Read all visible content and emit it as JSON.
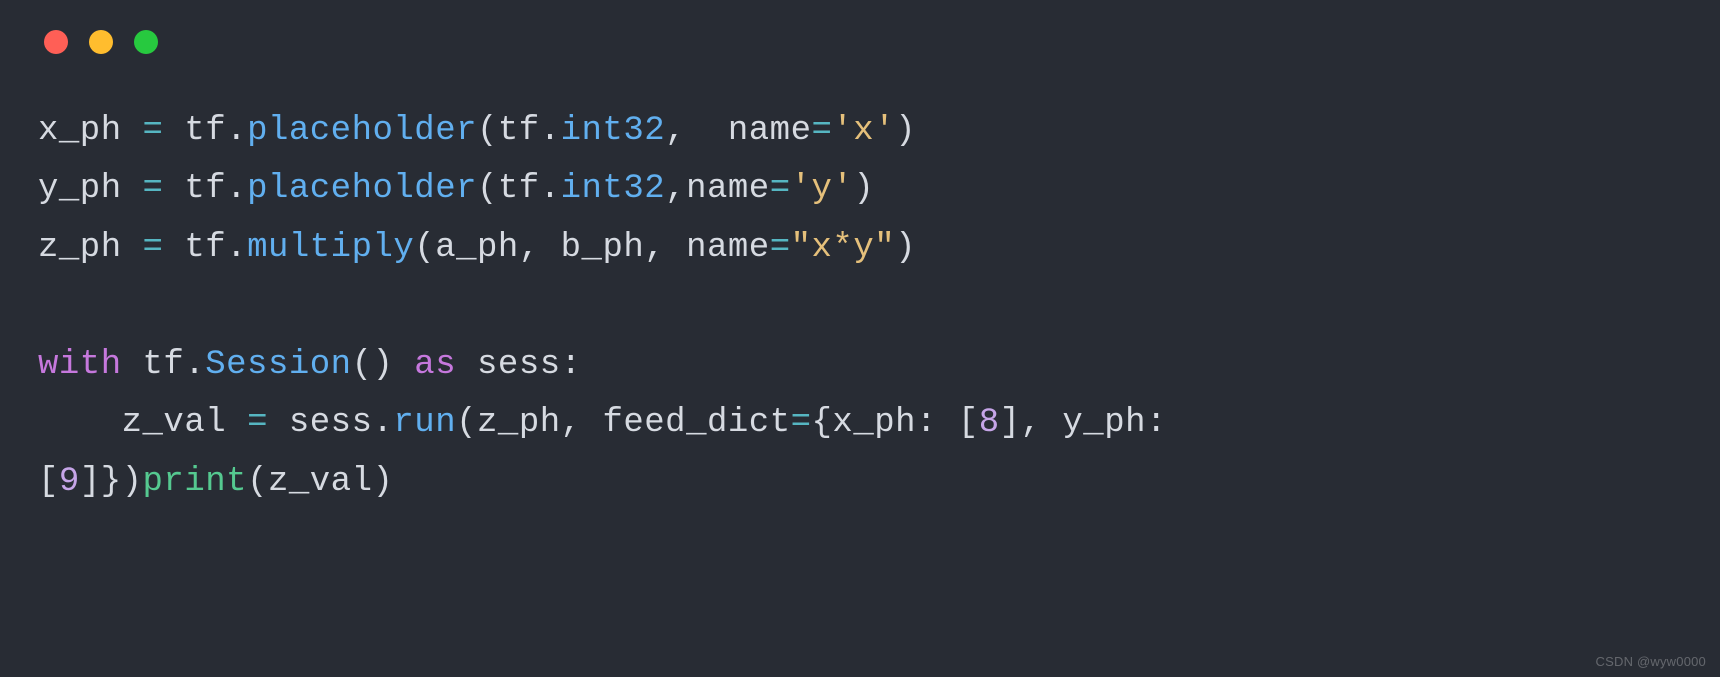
{
  "watermark": "CSDN @wyw0000",
  "code": {
    "l1": {
      "v_xph": "x_ph",
      "eq": "=",
      "tf": "tf",
      "dot": ".",
      "placeholder": "placeholder",
      "lp": "(",
      "tf2": "tf",
      "dot2": ".",
      "int32": "int32",
      "comma": ",",
      "sp": "  ",
      "name": "name",
      "eq2": "=",
      "str": "'x'",
      "rp": ")"
    },
    "l2": {
      "v_yph": "y_ph",
      "eq": "=",
      "tf": "tf",
      "dot": ".",
      "placeholder": "placeholder",
      "lp": "(",
      "tf2": "tf",
      "dot2": ".",
      "int32": "int32",
      "comma": ",",
      "name": "name",
      "eq2": "=",
      "str": "'y'",
      "rp": ")"
    },
    "l3": {
      "v_zph": "z_ph",
      "eq": "=",
      "tf": "tf",
      "dot": ".",
      "multiply": "multiply",
      "lp": "(",
      "a": "a_ph",
      "c1": ",",
      "sp": " ",
      "b": "b_ph",
      "c2": ",",
      "sp2": " ",
      "name": "name",
      "eq2": "=",
      "str": "\"x*y\"",
      "rp": ")"
    },
    "l5": {
      "with": "with",
      "sp": " ",
      "tf": "tf",
      "dot": ".",
      "session": "Session",
      "lp": "(",
      "rp": ")",
      "sp2": " ",
      "as": "as",
      "sp3": " ",
      "sess": "sess",
      "colon": ":"
    },
    "l6": {
      "indent": "    ",
      "zval": "z_val",
      "sp": " ",
      "eq": "=",
      "sp2": " ",
      "sess": "sess",
      "dot": ".",
      "run": "run",
      "lp": "(",
      "zph": "z_ph",
      "c1": ",",
      "sp3": " ",
      "feed": "feed_dict",
      "eq2": "=",
      "lb": "{",
      "xph": "x_ph",
      "colon": ":",
      "sp4": " ",
      "lb2": "[",
      "n8": "8",
      "rb2": "]",
      "c2": ",",
      "sp5": " ",
      "yph": "y_ph",
      "colon2": ":",
      "sp6": " "
    },
    "l7": {
      "lb": "[",
      "n9": "9",
      "rb": "]",
      "rcb": "}",
      "rp": ")",
      "print": "print",
      "lp": "(",
      "zval": "z_val",
      "rp2": ")"
    }
  }
}
